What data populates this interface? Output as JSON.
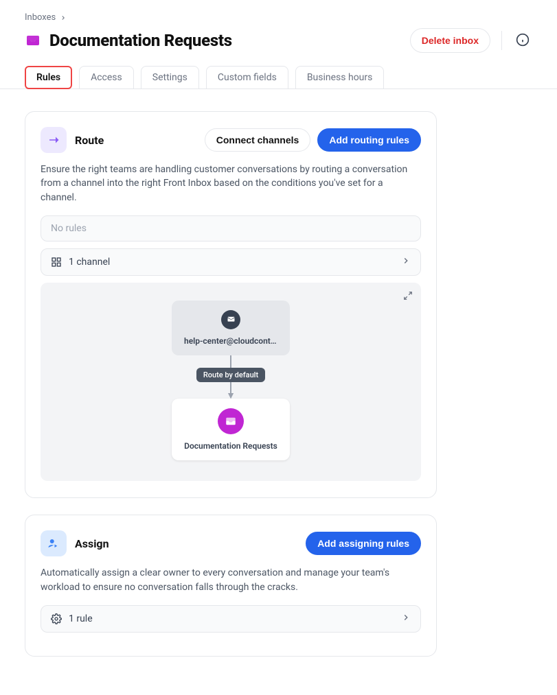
{
  "breadcrumb": {
    "parent": "Inboxes"
  },
  "header": {
    "title": "Documentation Requests",
    "delete_label": "Delete inbox"
  },
  "tabs": [
    {
      "label": "Rules",
      "active": true
    },
    {
      "label": "Access",
      "active": false
    },
    {
      "label": "Settings",
      "active": false
    },
    {
      "label": "Custom fields",
      "active": false
    },
    {
      "label": "Business hours",
      "active": false
    }
  ],
  "route": {
    "title": "Route",
    "connect_label": "Connect channels",
    "add_label": "Add routing rules",
    "description": "Ensure the right teams are handling customer conversations by routing a conversation from a channel into the right Front Inbox based on the conditions you've set for a channel.",
    "no_rules_label": "No rules",
    "channels_label": "1 channel",
    "diagram": {
      "source_label": "help-center@cloudconten...",
      "route_badge": "Route by default",
      "dest_label": "Documentation Requests"
    }
  },
  "assign": {
    "title": "Assign",
    "add_label": "Add assigning rules",
    "description": "Automatically assign a clear owner to every conversation and manage your team's workload to ensure no conversation falls through the cracks.",
    "rules_label": "1 rule"
  }
}
